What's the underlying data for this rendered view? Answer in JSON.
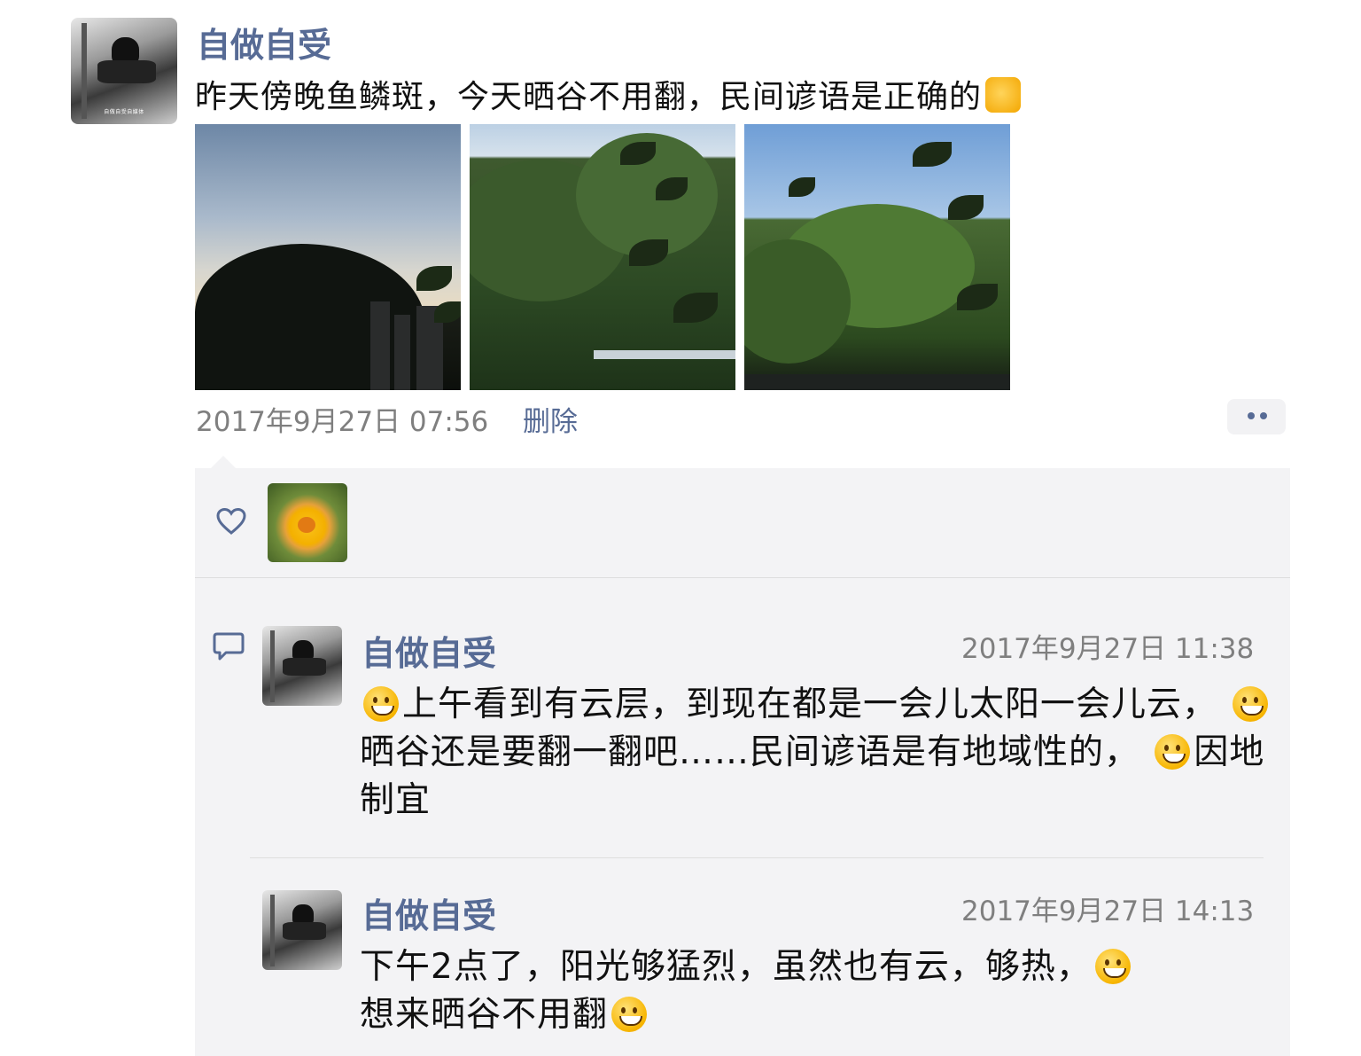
{
  "post": {
    "author": "自做自受",
    "avatar_caption": "自做自受自媒体",
    "text": "昨天傍晚鱼鳞斑，今天晒谷不用翻，民间谚语是正确的",
    "text_trailing_icon": "thumbs-up-emoji",
    "photos": [
      "sunset-sky-hill-photo",
      "forest-hill-photo",
      "sunny-hill-photo"
    ],
    "time": "2017年9月27日 07:56",
    "delete_label": "删除",
    "more_icon": "more-dots-icon"
  },
  "likes": {
    "icon": "heart-icon",
    "likers": [
      "yellow-flower-avatar"
    ]
  },
  "comments": {
    "icon": "comment-icon",
    "items": [
      {
        "author": "自做自受",
        "time": "2017年9月27日 11:38",
        "text_parts": [
          "上午看到有云层，到现在都是一会儿太阳一会儿云，",
          "晒谷还是要翻一翻吧……民间谚语是有地域性的，",
          "因地制宜"
        ]
      },
      {
        "author": "自做自受",
        "time": "2017年9月27日 14:13",
        "text_parts": [
          "下午2点了，阳光够猛烈，虽然也有云，够热，",
          "想来晒谷不用翻"
        ]
      }
    ]
  },
  "colors": {
    "link": "#576b95",
    "meta": "#7f7f7f",
    "panel": "#f3f3f5"
  }
}
